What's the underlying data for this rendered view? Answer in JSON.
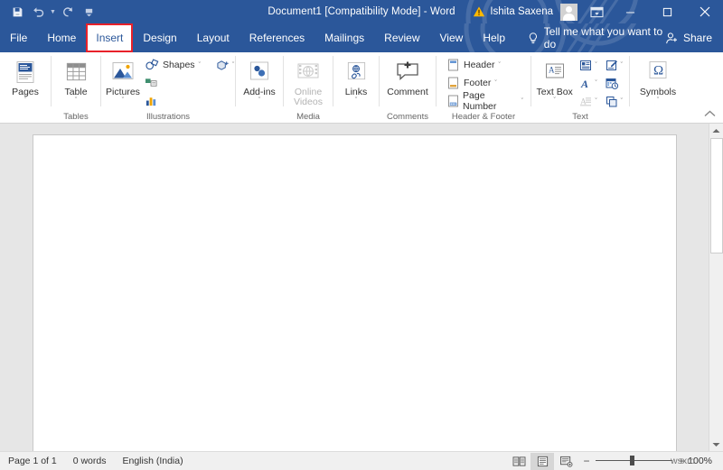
{
  "titlebar": {
    "quick_access": [
      {
        "name": "save-icon",
        "label": "Save"
      },
      {
        "name": "undo-icon",
        "label": "Undo"
      },
      {
        "name": "redo-icon",
        "label": "Redo"
      },
      {
        "name": "customize-quick-access-icon",
        "label": "Customize Quick Access Toolbar"
      }
    ],
    "document_title": "Document1 [Compatibility Mode]  -  Word",
    "account_name": "Ishita Saxena",
    "warning_icon": "warning-triangle-icon",
    "ribbon_display_options": "ribbon-display-options-icon",
    "minimize": "─",
    "maximize": "☐",
    "close": "✕"
  },
  "tabs": [
    {
      "label": "File",
      "active": false
    },
    {
      "label": "Home",
      "active": false
    },
    {
      "label": "Insert",
      "active": true,
      "highlighted": true
    },
    {
      "label": "Design",
      "active": false
    },
    {
      "label": "Layout",
      "active": false
    },
    {
      "label": "References",
      "active": false
    },
    {
      "label": "Mailings",
      "active": false
    },
    {
      "label": "Review",
      "active": false
    },
    {
      "label": "View",
      "active": false
    },
    {
      "label": "Help",
      "active": false
    }
  ],
  "tellme": {
    "icon": "lightbulb-icon",
    "text": "Tell me what you want to do"
  },
  "share": {
    "icon": "share-person-icon",
    "label": "Share"
  },
  "ribbon": {
    "highlight_color": "#e8212a",
    "accent_color": "#2b579a",
    "groups": [
      {
        "name": "pages",
        "label": "",
        "buttons": [
          {
            "name": "pages-button",
            "label": "Pages",
            "icon": "page-document-icon",
            "caret": "ˇ",
            "disabled": false
          }
        ]
      },
      {
        "name": "tables",
        "label": "Tables",
        "buttons": [
          {
            "name": "table-button",
            "label": "Table",
            "icon": "table-grid-icon",
            "caret": "ˇ",
            "disabled": false
          }
        ]
      },
      {
        "name": "illustrations",
        "label": "Illustrations",
        "buttons": [
          {
            "name": "pictures-button",
            "label": "Pictures",
            "icon": "picture-mountain-icon",
            "caret": "ˇ",
            "disabled": false
          }
        ],
        "small_buttons": [
          {
            "name": "shapes-button",
            "label": "Shapes",
            "icon": "shapes-icon",
            "caret": "ˇ"
          },
          {
            "name": "icons-3d-models-button",
            "label": "",
            "icon": "icons-3d-model-icon",
            "caret": "ˇ"
          },
          {
            "name": "smartart-button",
            "label": "",
            "icon": "smartart-icon",
            "caret": ""
          },
          {
            "name": "chart-button",
            "label": "",
            "icon": "chart-bar-icon",
            "caret": ""
          }
        ]
      },
      {
        "name": "add-ins",
        "label": "",
        "buttons": [
          {
            "name": "add-ins-button",
            "label": "Add-ins",
            "icon": "add-ins-puzzle-icon",
            "caret": "ˇ",
            "disabled": false
          }
        ]
      },
      {
        "name": "media",
        "label": "Media",
        "buttons": [
          {
            "name": "online-videos-button",
            "label": "Online Videos",
            "icon": "online-video-icon",
            "caret": "",
            "disabled": true
          }
        ]
      },
      {
        "name": "links",
        "label": "",
        "buttons": [
          {
            "name": "links-button",
            "label": "Links",
            "icon": "link-globe-icon",
            "caret": "ˇ",
            "disabled": false
          }
        ]
      },
      {
        "name": "comments",
        "label": "Comments",
        "buttons": [
          {
            "name": "comment-button",
            "label": "Comment",
            "icon": "comment-plus-icon",
            "caret": "",
            "disabled": false
          }
        ]
      },
      {
        "name": "header-footer",
        "label": "Header & Footer",
        "small_buttons": [
          {
            "name": "header-button",
            "label": "Header",
            "icon": "header-page-icon",
            "caret": "ˇ"
          },
          {
            "name": "footer-button",
            "label": "Footer",
            "icon": "footer-page-icon",
            "caret": "ˇ"
          },
          {
            "name": "page-number-button",
            "label": "Page Number",
            "icon": "page-number-icon",
            "caret": "ˇ"
          }
        ]
      },
      {
        "name": "text",
        "label": "Text",
        "buttons": [
          {
            "name": "text-box-button",
            "label": "Text Box",
            "icon": "text-box-icon",
            "caret": "ˇ",
            "disabled": false
          }
        ],
        "small_buttons": [
          {
            "name": "quick-parts-button",
            "label": "",
            "icon": "quick-parts-icon",
            "caret": "ˇ"
          },
          {
            "name": "signature-line-button",
            "label": "",
            "icon": "signature-line-icon",
            "caret": "ˇ"
          },
          {
            "name": "wordart-button",
            "label": "",
            "icon": "wordart-a-icon",
            "caret": "ˇ"
          },
          {
            "name": "date-time-button",
            "label": "",
            "icon": "date-time-icon",
            "caret": ""
          },
          {
            "name": "drop-cap-button",
            "label": "",
            "icon": "drop-cap-icon",
            "caret": "ˇ",
            "disabled": true
          },
          {
            "name": "object-button",
            "label": "",
            "icon": "object-icon",
            "caret": "ˇ"
          }
        ]
      },
      {
        "name": "symbols",
        "label": "",
        "buttons": [
          {
            "name": "symbols-button",
            "label": "Symbols",
            "icon": "omega-symbol-icon",
            "caret": "ˇ",
            "disabled": false
          }
        ]
      }
    ],
    "collapse_icon": "chevron-up-icon"
  },
  "document": {
    "page_background": "#ffffff",
    "canvas_background": "#e6e6e6"
  },
  "scrollbar": {
    "up_arrow": "▲",
    "down_arrow": "▼"
  },
  "status": {
    "page_info": "Page 1 of 1",
    "word_count": "0 words",
    "language": "English (India)",
    "views": [
      {
        "name": "read-mode-view-button",
        "icon": "read-mode-icon",
        "active": false
      },
      {
        "name": "print-layout-view-button",
        "icon": "print-layout-icon",
        "active": true
      },
      {
        "name": "web-layout-view-button",
        "icon": "web-layout-icon",
        "active": false
      }
    ],
    "zoom_out": "−",
    "zoom_in": "+",
    "zoom_level": "100%",
    "zoom_ghost": "wsxm"
  }
}
